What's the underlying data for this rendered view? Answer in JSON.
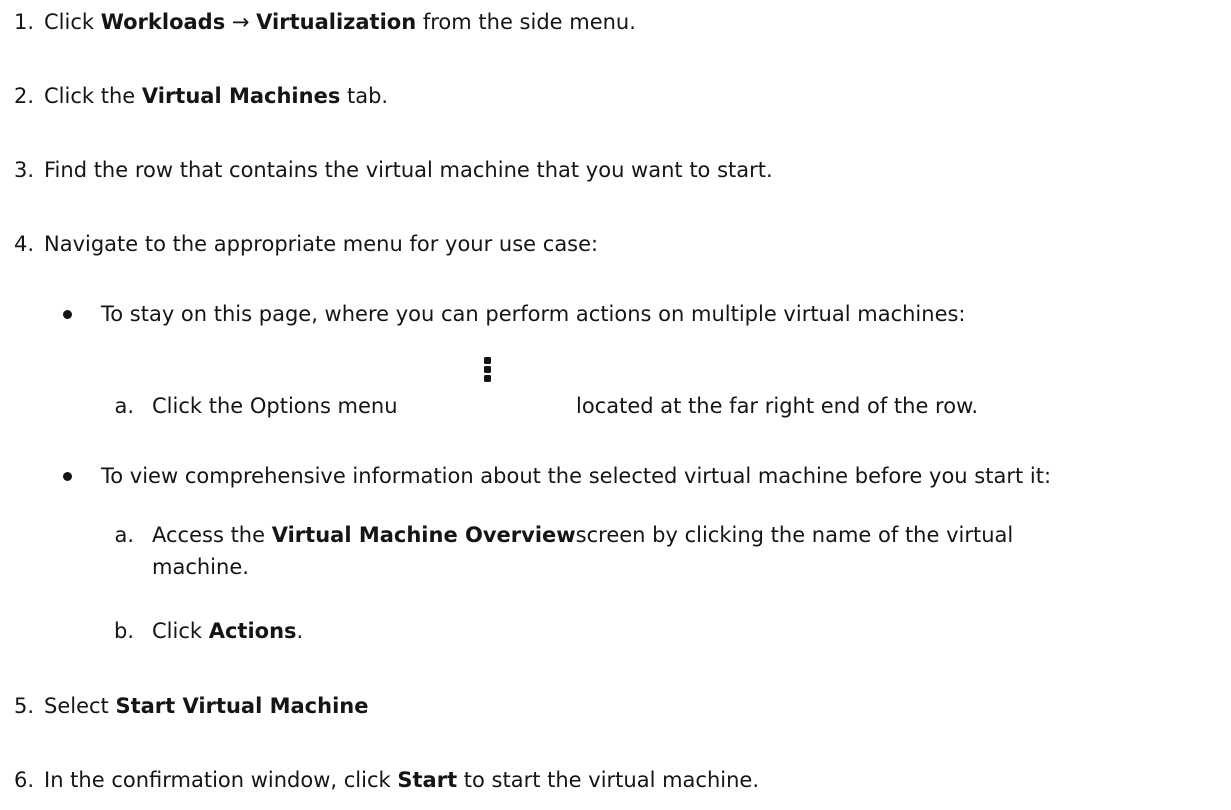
{
  "steps": {
    "s1": {
      "num": "1.",
      "pre": "Click ",
      "b1": "Workloads",
      "arrow": " → ",
      "b2": "Virtualization",
      "post": " from the side menu."
    },
    "s2": {
      "num": "2.",
      "pre": "Click the ",
      "b1": "Virtual Machines",
      "post": " tab."
    },
    "s3": {
      "num": "3.",
      "text": "Find the row that contains the virtual machine that you want to start."
    },
    "s4": {
      "num": "4.",
      "text": "Navigate to the appropriate menu for your use case:"
    },
    "bullet1": {
      "text": "To stay on this page, where you can perform actions on multiple virtual machines:"
    },
    "sub1a": {
      "num": "a.",
      "pre": "Click the Options menu",
      "post": "located at the far right end of the row.",
      "icon": "kebab-options-icon"
    },
    "bullet2": {
      "text": "To view comprehensive information about the selected virtual machine before you start it:"
    },
    "sub2a": {
      "num": "a.",
      "pre": "Access the ",
      "b1": "Virtual Machine Overview",
      "post": "screen by clicking the name of the virtual",
      "cont": "machine."
    },
    "sub2b": {
      "num": "b.",
      "pre": "Click ",
      "b1": "Actions",
      "post": "."
    },
    "s5": {
      "num": "5.",
      "pre": "Select ",
      "b1": "Start Virtual Machine"
    },
    "s6": {
      "num": "6.",
      "pre": "In the confirmation window, click ",
      "b1": "Start",
      "post": " to start the virtual machine."
    }
  }
}
